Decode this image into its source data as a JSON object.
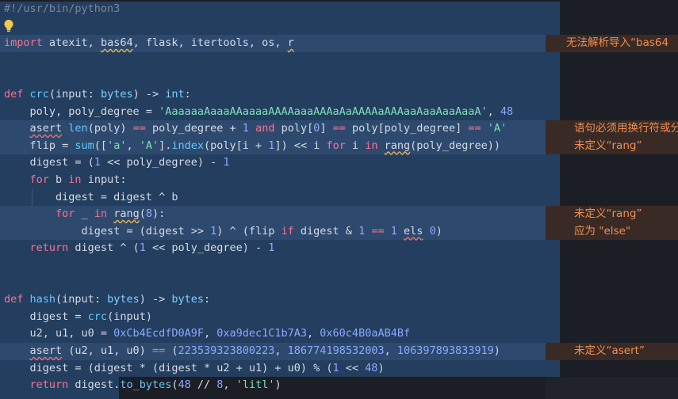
{
  "lines": [
    [
      {
        "t": "#!/usr/bin/python3",
        "c": "cm"
      }
    ],
    [],
    [
      {
        "t": "import",
        "c": "kw"
      },
      {
        "t": " atexit, ",
        "c": "pl"
      },
      {
        "t": "bas64",
        "c": "pl",
        "u": "y"
      },
      {
        "t": ", flask, itertools, os, ",
        "c": "pl"
      },
      {
        "t": "r",
        "c": "pl",
        "u": "y"
      }
    ],
    [],
    [],
    [
      {
        "t": "def",
        "c": "kw"
      },
      {
        "t": " ",
        "c": "pl"
      },
      {
        "t": "crc",
        "c": "fn"
      },
      {
        "t": "(input: ",
        "c": "pl"
      },
      {
        "t": "bytes",
        "c": "tp"
      },
      {
        "t": ") -> ",
        "c": "pl"
      },
      {
        "t": "int",
        "c": "tp"
      },
      {
        "t": ":",
        "c": "pl"
      }
    ],
    [
      {
        "t": "    poly, poly_degree = ",
        "c": "pl"
      },
      {
        "t": "'AaaaaaAaaaAAaaaaAAAAaaaAAAaAaAAAAaAAAaaAaaAaaAaaA'",
        "c": "str"
      },
      {
        "t": ", ",
        "c": "pl"
      },
      {
        "t": "48",
        "c": "num"
      }
    ],
    [
      {
        "t": "    ",
        "c": "pl"
      },
      {
        "t": "asert",
        "c": "pl",
        "u": "r"
      },
      {
        "t": " ",
        "c": "pl"
      },
      {
        "t": "len",
        "c": "fn"
      },
      {
        "t": "(poly) ",
        "c": "pl"
      },
      {
        "t": "==",
        "c": "op"
      },
      {
        "t": " poly_degree + ",
        "c": "pl"
      },
      {
        "t": "1",
        "c": "num"
      },
      {
        "t": " ",
        "c": "pl"
      },
      {
        "t": "and",
        "c": "kw"
      },
      {
        "t": " poly[",
        "c": "pl"
      },
      {
        "t": "0",
        "c": "num"
      },
      {
        "t": "] ",
        "c": "pl"
      },
      {
        "t": "==",
        "c": "op"
      },
      {
        "t": " poly[poly_degree] ",
        "c": "pl"
      },
      {
        "t": "==",
        "c": "op"
      },
      {
        "t": " ",
        "c": "pl"
      },
      {
        "t": "'A'",
        "c": "str"
      }
    ],
    [
      {
        "t": "    flip = ",
        "c": "pl"
      },
      {
        "t": "sum",
        "c": "fn"
      },
      {
        "t": "([",
        "c": "pl"
      },
      {
        "t": "'a'",
        "c": "str"
      },
      {
        "t": ", ",
        "c": "pl"
      },
      {
        "t": "'A'",
        "c": "str"
      },
      {
        "t": "].",
        "c": "pl"
      },
      {
        "t": "index",
        "c": "fn"
      },
      {
        "t": "(poly[i + ",
        "c": "pl"
      },
      {
        "t": "1",
        "c": "num"
      },
      {
        "t": "]) << i ",
        "c": "pl"
      },
      {
        "t": "for",
        "c": "kw"
      },
      {
        "t": " i ",
        "c": "pl"
      },
      {
        "t": "in",
        "c": "kw"
      },
      {
        "t": " ",
        "c": "pl"
      },
      {
        "t": "rang",
        "c": "pl",
        "u": "y"
      },
      {
        "t": "(poly_degree))",
        "c": "pl"
      }
    ],
    [
      {
        "t": "    digest = (",
        "c": "pl"
      },
      {
        "t": "1",
        "c": "num"
      },
      {
        "t": " << poly_degree) - ",
        "c": "pl"
      },
      {
        "t": "1",
        "c": "num"
      }
    ],
    [
      {
        "t": "    ",
        "c": "pl"
      },
      {
        "t": "for",
        "c": "kw"
      },
      {
        "t": " b ",
        "c": "pl"
      },
      {
        "t": "in",
        "c": "kw"
      },
      {
        "t": " input:",
        "c": "pl"
      }
    ],
    [
      {
        "t": "        digest = digest ^ b",
        "c": "pl"
      }
    ],
    [
      {
        "t": "        ",
        "c": "pl"
      },
      {
        "t": "for",
        "c": "kw"
      },
      {
        "t": " _ ",
        "c": "pl"
      },
      {
        "t": "in",
        "c": "kw"
      },
      {
        "t": " ",
        "c": "pl"
      },
      {
        "t": "rang",
        "c": "pl",
        "u": "y"
      },
      {
        "t": "(",
        "c": "pl"
      },
      {
        "t": "8",
        "c": "num"
      },
      {
        "t": "):",
        "c": "pl"
      }
    ],
    [
      {
        "t": "            digest = (digest >> ",
        "c": "pl"
      },
      {
        "t": "1",
        "c": "num"
      },
      {
        "t": ") ^ (flip ",
        "c": "pl"
      },
      {
        "t": "if",
        "c": "kw"
      },
      {
        "t": " digest & ",
        "c": "pl"
      },
      {
        "t": "1",
        "c": "num"
      },
      {
        "t": " ",
        "c": "pl"
      },
      {
        "t": "==",
        "c": "op"
      },
      {
        "t": " ",
        "c": "pl"
      },
      {
        "t": "1",
        "c": "num"
      },
      {
        "t": " ",
        "c": "pl"
      },
      {
        "t": "els",
        "c": "pl",
        "u": "r"
      },
      {
        "t": " ",
        "c": "pl"
      },
      {
        "t": "0",
        "c": "num"
      },
      {
        "t": ")",
        "c": "pl"
      }
    ],
    [
      {
        "t": "    ",
        "c": "pl"
      },
      {
        "t": "return",
        "c": "kw"
      },
      {
        "t": " digest ^ (",
        "c": "pl"
      },
      {
        "t": "1",
        "c": "num"
      },
      {
        "t": " << poly_degree) - ",
        "c": "pl"
      },
      {
        "t": "1",
        "c": "num"
      }
    ],
    [],
    [],
    [
      {
        "t": "def",
        "c": "kw"
      },
      {
        "t": " ",
        "c": "pl"
      },
      {
        "t": "hash",
        "c": "fn"
      },
      {
        "t": "(input: ",
        "c": "pl"
      },
      {
        "t": "bytes",
        "c": "tp"
      },
      {
        "t": ") -> ",
        "c": "pl"
      },
      {
        "t": "bytes",
        "c": "tp"
      },
      {
        "t": ":",
        "c": "pl"
      }
    ],
    [
      {
        "t": "    digest = ",
        "c": "pl"
      },
      {
        "t": "crc",
        "c": "fn"
      },
      {
        "t": "(input)",
        "c": "pl"
      }
    ],
    [
      {
        "t": "    u2, u1, u0 = ",
        "c": "pl"
      },
      {
        "t": "0xCb4EcdfD0A9F",
        "c": "num"
      },
      {
        "t": ", ",
        "c": "pl"
      },
      {
        "t": "0xa9dec1C1b7A3",
        "c": "num"
      },
      {
        "t": ", ",
        "c": "pl"
      },
      {
        "t": "0x60c4B0aAB4Bf",
        "c": "num"
      }
    ],
    [
      {
        "t": "    ",
        "c": "pl"
      },
      {
        "t": "asert",
        "c": "pl",
        "u": "r"
      },
      {
        "t": " (u2, u1, u0) ",
        "c": "pl"
      },
      {
        "t": "==",
        "c": "op"
      },
      {
        "t": " (",
        "c": "pl"
      },
      {
        "t": "223539323800223",
        "c": "num"
      },
      {
        "t": ", ",
        "c": "pl"
      },
      {
        "t": "186774198532003",
        "c": "num"
      },
      {
        "t": ", ",
        "c": "pl"
      },
      {
        "t": "106397893833919",
        "c": "num"
      },
      {
        "t": ")",
        "c": "pl"
      }
    ],
    [
      {
        "t": "    digest = (digest * (digest * u2 + u1) + u0) % (",
        "c": "pl"
      },
      {
        "t": "1",
        "c": "num"
      },
      {
        "t": " << ",
        "c": "pl"
      },
      {
        "t": "48",
        "c": "num"
      },
      {
        "t": ")",
        "c": "pl"
      }
    ],
    [
      {
        "t": "    ",
        "c": "pl"
      },
      {
        "t": "return",
        "c": "kw"
      },
      {
        "t": " digest.",
        "c": "pl"
      },
      {
        "t": "to_bytes",
        "c": "fn"
      },
      {
        "t": "(",
        "c": "pl"
      },
      {
        "t": "48",
        "c": "num"
      },
      {
        "t": " // ",
        "c": "pl"
      },
      {
        "t": "8",
        "c": "num"
      },
      {
        "t": ", ",
        "c": "pl"
      },
      {
        "t": "'litl'",
        "c": "str"
      },
      {
        "t": ")",
        "c": "pl"
      }
    ]
  ],
  "highlighted_lines": [
    2,
    7,
    8,
    12,
    13,
    20
  ],
  "diagnostics": [
    {
      "line": 2,
      "text": "无法解析导入“bas64"
    },
    {
      "line": 7,
      "text": "语句必须用换行符或分"
    },
    {
      "line": 8,
      "text": "未定义“rang”"
    },
    {
      "line": 12,
      "text": "未定义“rang”"
    },
    {
      "line": 13,
      "text": "应为 \"else\""
    },
    {
      "line": 20,
      "text": "未定义“asert”"
    }
  ],
  "lightbulb_icon": "lightbulb-icon",
  "colors": {
    "background": "#1c1e26",
    "selection": "#233e5f",
    "current_line": "#2d4a6e",
    "diagnostic_bg": "#3a2a25",
    "diagnostic_text": "#ee8f52"
  }
}
